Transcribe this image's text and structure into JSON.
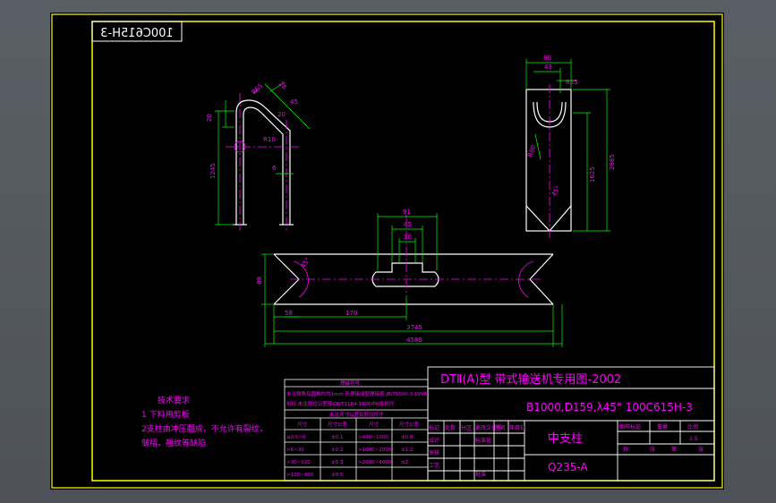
{
  "drawing_number_mirrored": "100C615H-3",
  "title_block": {
    "main_title": "DTⅡ(A)型  带式输送机专用图-2002",
    "spec": "B1000,D159,λ45°  100C615H-3",
    "part_name": "中支柱",
    "material": "Q235-A",
    "scale_header": [
      "图样标记",
      "重量",
      "比例"
    ],
    "scale_value": "1:5",
    "sheet_labels": [
      "共",
      "张",
      "第",
      "张"
    ],
    "sign_rows": [
      "标记",
      "处数",
      "分区",
      "更改文件号",
      "签名",
      "年月日"
    ],
    "roles": [
      "设计",
      "审核",
      "工艺",
      "标准化",
      "批准"
    ]
  },
  "tech_requirements": {
    "title": "技术要求",
    "items": [
      "1 下料用剪板",
      "2支柱由冲压翻成，不允许有裂纹，",
      "   皱褶，翘纹等缺陷"
    ]
  },
  "tolerance_table": {
    "header": "焊接符号",
    "notes": [
      "未注倒角及圆角均为1mm  所焊接成型焊接按 JB/T5000.3-1998",
      "执行  未注形位公差按GB/T1184-1996中K级执行"
    ],
    "subheader": "未注尺寸公差及剪切尺寸",
    "columns": [
      "尺寸",
      "尺寸公差",
      "尺寸",
      "尺寸公差"
    ],
    "rows": [
      [
        "≥0.5~6",
        "±0.1",
        ">400~1000",
        "±0.8"
      ],
      [
        ">6~30",
        "±0.2",
        ">1000~2000",
        "±1.2"
      ],
      [
        ">30~120",
        "±0.3",
        ">2000~4000",
        "±2"
      ],
      [
        ">120~400",
        "±0.5",
        "",
        ""
      ]
    ]
  },
  "dimensions": {
    "view1": [
      "R65",
      "28",
      "45",
      "20",
      "20",
      "R10",
      "1245",
      "6"
    ],
    "view2": [
      "80",
      "43",
      "R25",
      "R80",
      "2985",
      "1625",
      "45°"
    ],
    "view3": [
      "91",
      "45",
      "30",
      "89",
      "45°",
      "170",
      "3745",
      "4585",
      "58"
    ]
  },
  "colors": {
    "background": "#000000",
    "frame": "#ffff00",
    "outline": "#ffffff",
    "dimension": "#00ff00",
    "centerline": "#ff00ff",
    "text": "#ff00ff"
  }
}
